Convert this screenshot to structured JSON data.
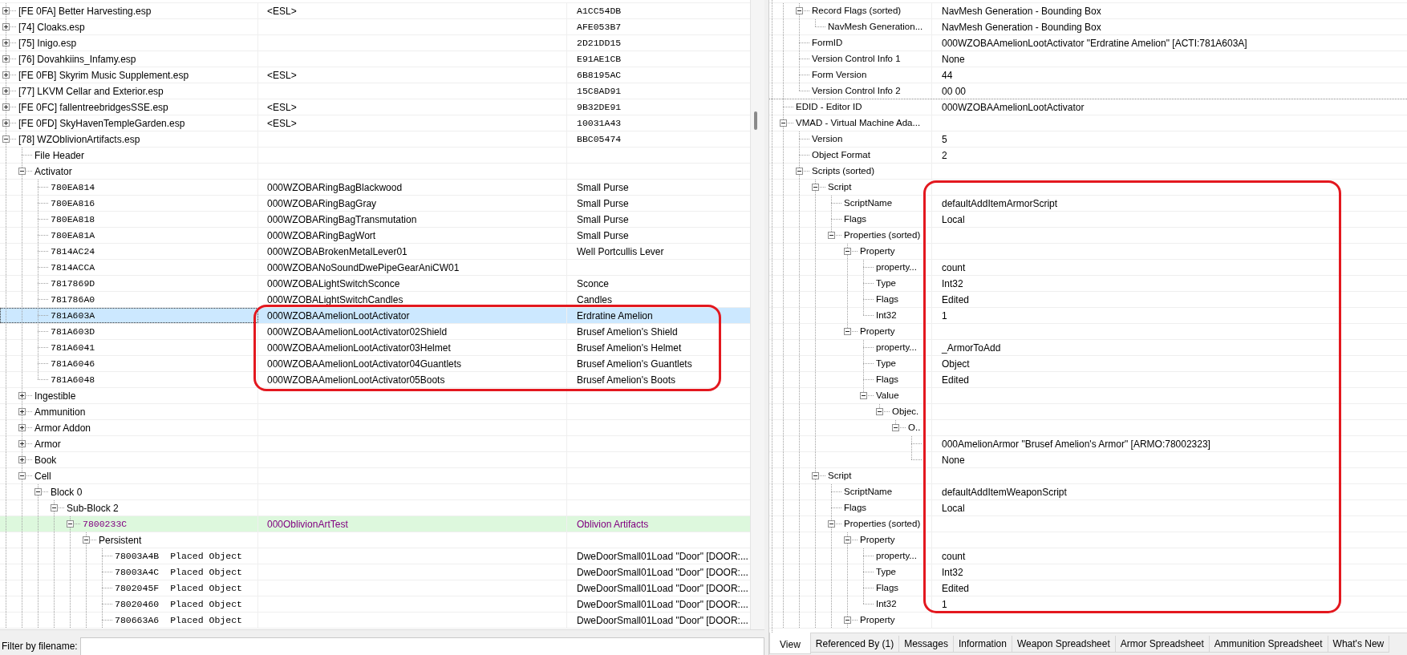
{
  "plugin_tree": {
    "rows": [
      {
        "label": "[FE 0FA] Better Harvesting.esp",
        "column_2": "<ESL>",
        "column_3": "A1CC54DB",
        "expanded": false
      },
      {
        "label": "[74] Cloaks.esp",
        "column_3": "AFE053B7",
        "expanded": false
      },
      {
        "label": "[75] Inigo.esp",
        "column_3": "2D21DD15",
        "expanded": false
      },
      {
        "label": "[76] Dovahkiins_Infamy.esp",
        "column_3": "E91AE1CB",
        "expanded": false
      },
      {
        "label": "[FE 0FB] Skyrim Music Supplement.esp",
        "column_2": "<ESL>",
        "column_3": "6B8195AC",
        "expanded": false
      },
      {
        "label": "[77] LKVM Cellar and Exterior.esp",
        "column_3": "15C8AD91",
        "expanded": false
      },
      {
        "label": "[FE 0FC] fallentreebridgesSSE.esp",
        "column_2": "<ESL>",
        "column_3": "9B32DE91",
        "expanded": false
      },
      {
        "label": "[FE 0FD] SkyHavenTempleGarden.esp",
        "column_2": "<ESL>",
        "column_3": "10031A43",
        "expanded": false
      },
      {
        "label": "[78] WZOblivionArtifacts.esp",
        "column_3": "BBC05474",
        "expanded": true,
        "children": [
          {
            "label": "File Header"
          },
          {
            "label": "Activator",
            "expanded": true,
            "children": [
              {
                "form_id": "780EA814",
                "column_2": "000WZOBARingBagBlackwood",
                "column_3": "Small Purse",
                "selected": false
              },
              {
                "form_id": "780EA816",
                "column_2": "000WZOBARingBagGray",
                "column_3": "Small Purse",
                "selected": false
              },
              {
                "form_id": "780EA818",
                "column_2": "000WZOBARingBagTransmutation",
                "column_3": "Small Purse",
                "selected": false
              },
              {
                "form_id": "780EA81A",
                "column_2": "000WZOBARingBagWort",
                "column_3": "Small Purse",
                "selected": false
              },
              {
                "form_id": "7814AC24",
                "column_2": "000WZOBABrokenMetalLever01",
                "column_3": "Well Portcullis Lever",
                "selected": false
              },
              {
                "form_id": "7814ACCA",
                "column_2": "000WZOBANoSoundDwePipeGearAniCW01",
                "selected": false
              },
              {
                "form_id": "7817869D",
                "column_2": "000WZOBALightSwitchSconce",
                "column_3": "Sconce",
                "selected": false
              },
              {
                "form_id": "781786A0",
                "column_2": "000WZOBALightSwitchCandles",
                "column_3": "Candles",
                "selected": false
              },
              {
                "form_id": "781A603A",
                "column_2": "000WZOBAAmelionLootActivator",
                "column_3": "Erdratine Amelion",
                "selected": true
              },
              {
                "form_id": "781A603D",
                "column_2": "000WZOBAAmelionLootActivator02Shield",
                "column_3": "Brusef Amelion's Shield",
                "selected": false
              },
              {
                "form_id": "781A6041",
                "column_2": "000WZOBAAmelionLootActivator03Helmet",
                "column_3": "Brusef Amelion's Helmet",
                "selected": false
              },
              {
                "form_id": "781A6046",
                "column_2": "000WZOBAAmelionLootActivator04Guantlets",
                "column_3": "Brusef Amelion's Guantlets",
                "selected": false
              },
              {
                "form_id": "781A6048",
                "column_2": "000WZOBAAmelionLootActivator05Boots",
                "column_3": "Brusef Amelion's Boots",
                "selected": false
              }
            ]
          },
          {
            "label": "Ingestible",
            "expanded": false
          },
          {
            "label": "Ammunition",
            "expanded": false
          },
          {
            "label": "Armor Addon",
            "expanded": false
          },
          {
            "label": "Armor",
            "expanded": false
          },
          {
            "label": "Book",
            "expanded": false
          },
          {
            "label": "Cell",
            "expanded": true,
            "children": [
              {
                "label": "Block 0",
                "expanded": true,
                "children": [
                  {
                    "label": "Sub-Block 2",
                    "expanded": true,
                    "children": [
                      {
                        "form_id": "7800233C",
                        "column_2": "000OblivionArtTest",
                        "column_3": "Oblivion Artifacts",
                        "highlighted": true,
                        "expanded": true,
                        "children": [
                          {
                            "label": "Persistent",
                            "expanded": true,
                            "children": [
                              {
                                "form_id": "78003A4B",
                                "record_type": "Placed Object",
                                "column_3": "DweDoorSmall01Load \"Door\" [DOOR:..."
                              },
                              {
                                "form_id": "78003A4C",
                                "record_type": "Placed Object",
                                "column_3": "DweDoorSmall01Load \"Door\" [DOOR:..."
                              },
                              {
                                "form_id": "7802045F",
                                "record_type": "Placed Object",
                                "column_3": "DweDoorSmall01Load \"Door\" [DOOR:..."
                              },
                              {
                                "form_id": "78020460",
                                "record_type": "Placed Object",
                                "column_3": "DweDoorSmall01Load \"Door\" [DOOR:..."
                              },
                              {
                                "form_id": "780663A6",
                                "record_type": "Placed Object",
                                "column_3": "DweDoorSmall01Load \"Door\" [DOOR:..."
                              }
                            ]
                          }
                        ]
                      }
                    ]
                  }
                ]
              }
            ]
          }
        ]
      }
    ],
    "annotations": [
      {
        "kind": "frame"
      }
    ]
  },
  "filter": {
    "label": "Filter by filename:"
  },
  "record_tree": {
    "rows": [
      {
        "children": [
          {
            "label": "Record Flags (sorted)",
            "column_2": "NavMesh Generation - Bounding Box",
            "expanded": true,
            "children": [
              {
                "label": "NavMesh Generation...",
                "column_2": "NavMesh Generation - Bounding Box"
              }
            ]
          },
          {
            "label": "FormID",
            "column_2": "000WZOBAAmelionLootActivator \"Erdratine Amelion\" [ACTI:781A603A]"
          },
          {
            "label": "Version Control Info 1",
            "column_2": "None"
          },
          {
            "label": "Form Version",
            "column_2": "44"
          },
          {
            "label": "Version Control Info 2",
            "column_2": "00 00"
          }
        ]
      },
      {
        "label": "EDID - Editor ID",
        "column_2": "000WZOBAAmelionLootActivator"
      },
      {
        "label": "VMAD - Virtual Machine Ada...",
        "expanded": true,
        "children": [
          {
            "label": "Version",
            "column_2": "5"
          },
          {
            "label": "Object Format",
            "column_2": "2"
          },
          {
            "label": "Scripts (sorted)",
            "expanded": true,
            "children": [
              {
                "label": "Script",
                "expanded": true,
                "children": [
                  {
                    "label": "ScriptName",
                    "column_2": "defaultAddItemArmorScript"
                  },
                  {
                    "label": "Flags",
                    "column_2": "Local"
                  },
                  {
                    "label": "Properties (sorted)",
                    "expanded": true,
                    "children": [
                      {
                        "label": "Property",
                        "expanded": true,
                        "children": [
                          {
                            "label": "property...",
                            "column_2": "count"
                          },
                          {
                            "label": "Type",
                            "column_2": "Int32"
                          },
                          {
                            "label": "Flags",
                            "column_2": "Edited"
                          },
                          {
                            "label": "Int32",
                            "column_2": "1"
                          }
                        ]
                      },
                      {
                        "label": "Property",
                        "expanded": true,
                        "children": [
                          {
                            "label": "property...",
                            "column_2": "_ArmorToAdd"
                          },
                          {
                            "label": "Type",
                            "column_2": "Object"
                          },
                          {
                            "label": "Flags",
                            "column_2": "Edited"
                          },
                          {
                            "label": "Value",
                            "expanded": true,
                            "children": [
                              {
                                "label": "Objec.",
                                "expanded": true,
                                "children": [
                                  {
                                    "label": "O..",
                                    "expanded": true,
                                    "children": [
                                      {
                                        "column_2": "000AmelionArmor \"Brusef Amelion's Armor\" [ARMO:78002323]"
                                      },
                                      {
                                        "column_2": "None"
                                      }
                                    ]
                                  }
                                ]
                              }
                            ]
                          }
                        ]
                      }
                    ]
                  }
                ]
              },
              {
                "label": "Script",
                "expanded": true,
                "children": [
                  {
                    "label": "ScriptName",
                    "column_2": "defaultAddItemWeaponScript"
                  },
                  {
                    "label": "Flags",
                    "column_2": "Local"
                  },
                  {
                    "label": "Properties (sorted)",
                    "expanded": true,
                    "children": [
                      {
                        "label": "Property",
                        "expanded": true,
                        "children": [
                          {
                            "label": "property...",
                            "column_2": "count"
                          },
                          {
                            "label": "Type",
                            "column_2": "Int32"
                          },
                          {
                            "label": "Flags",
                            "column_2": "Edited"
                          },
                          {
                            "label": "Int32",
                            "column_2": "1"
                          }
                        ]
                      },
                      {
                        "label": "Property",
                        "expanded": true
                      }
                    ]
                  }
                ]
              }
            ]
          }
        ]
      }
    ],
    "annotations": [
      {
        "kind": "frame"
      }
    ]
  },
  "tabs": [
    {
      "label": "View",
      "selected": true
    },
    {
      "label": "Referenced By (1)",
      "selected": false
    },
    {
      "label": "Messages",
      "selected": false
    },
    {
      "label": "Information",
      "selected": false
    },
    {
      "label": "Weapon Spreadsheet",
      "selected": false
    },
    {
      "label": "Armor Spreadsheet",
      "selected": false
    },
    {
      "label": "Ammunition Spreadsheet",
      "selected": false
    },
    {
      "label": "What's New",
      "selected": false
    }
  ]
}
